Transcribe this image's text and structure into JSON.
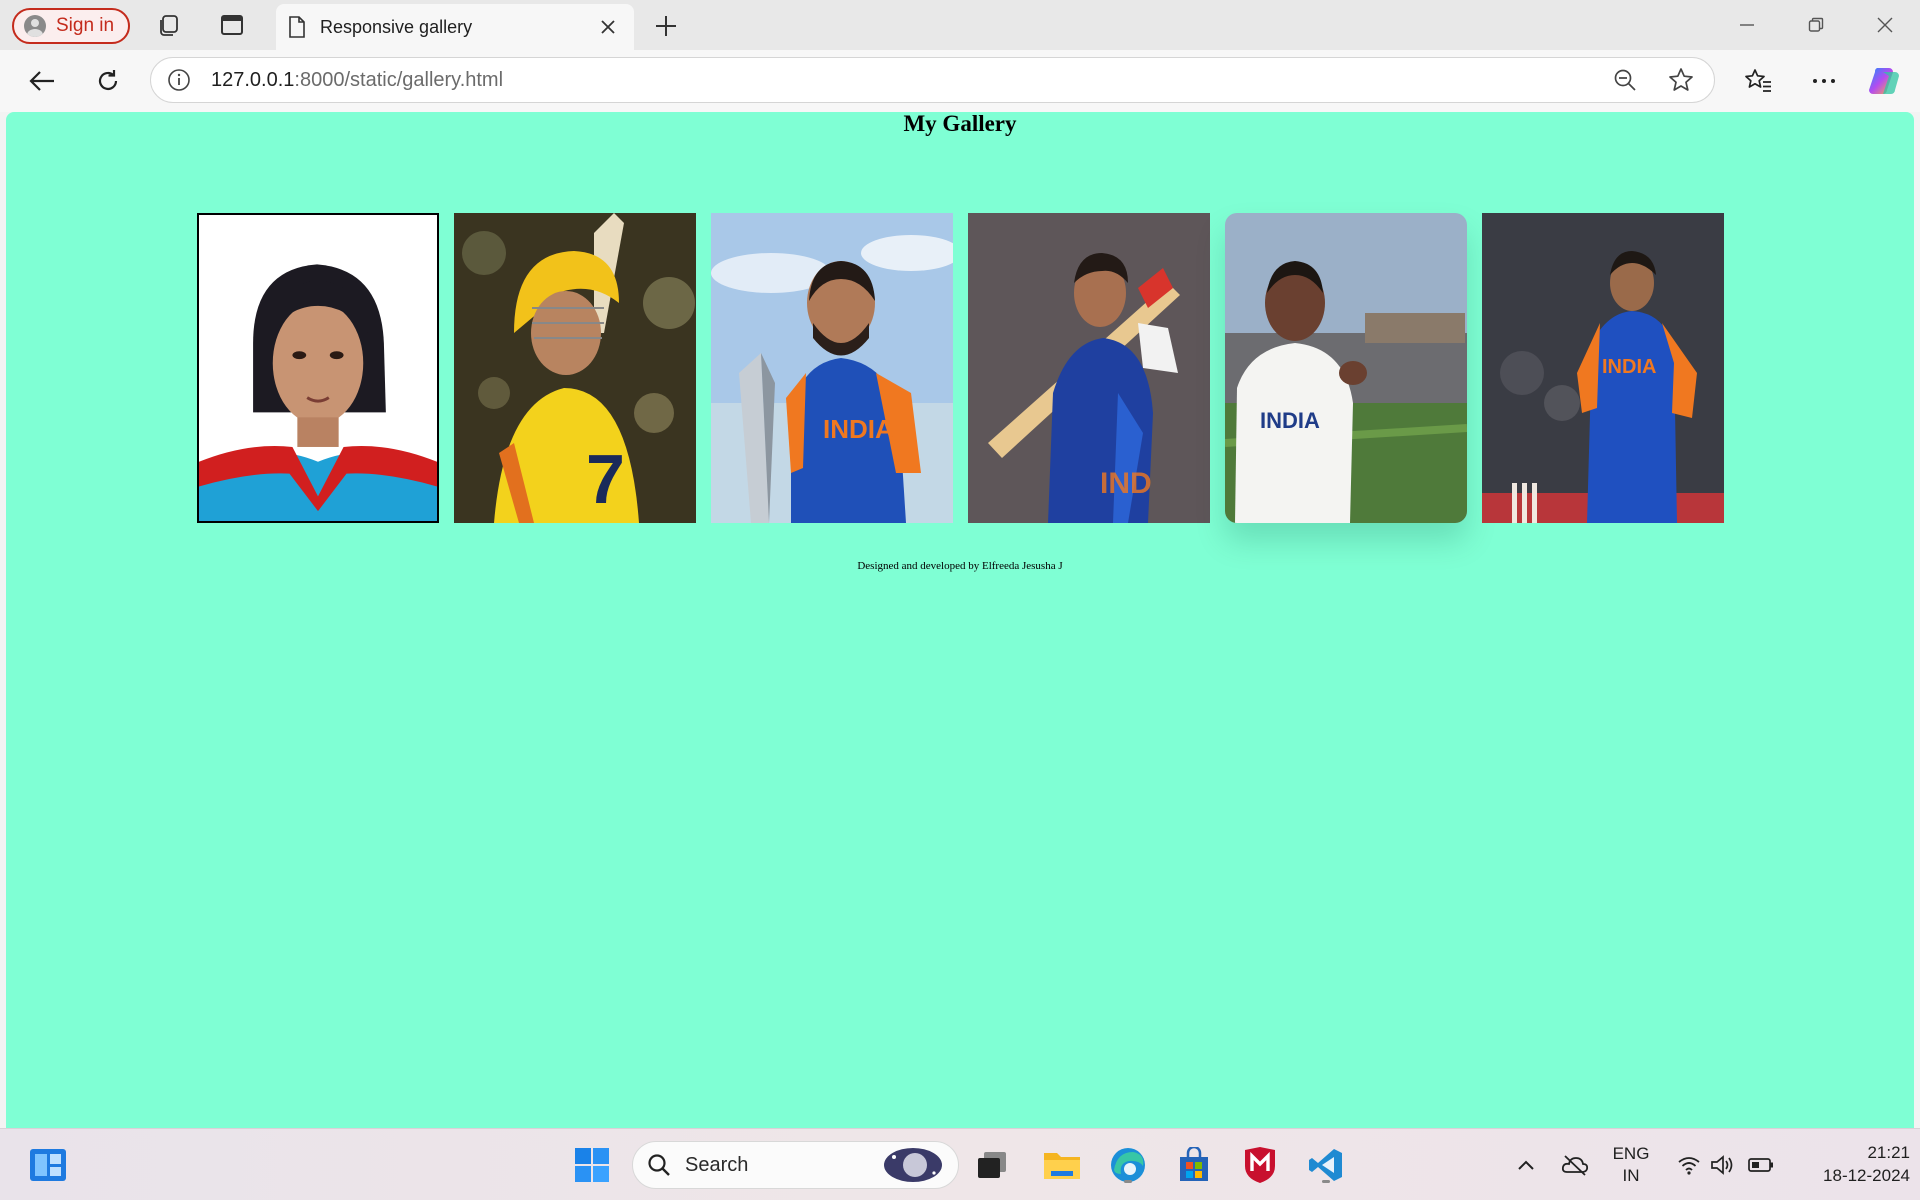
{
  "browser": {
    "signin_label": "Sign in",
    "tab_title": "Responsive gallery",
    "url_host": "127.0.0.1",
    "url_rest": ":8000/static/gallery.html"
  },
  "page": {
    "title": "My Gallery",
    "photos": [
      {
        "subject": "portrait photo"
      },
      {
        "subject": "cricketer in yellow jersey"
      },
      {
        "subject": "cricketer with trophy"
      },
      {
        "subject": "batsman in blue jersey"
      },
      {
        "subject": "cricketer in white test jersey"
      },
      {
        "subject": "bowler in blue-orange jersey"
      }
    ],
    "footer": "Designed and developed by Elfreeda Jesusha J"
  },
  "taskbar": {
    "search_label": "Search",
    "lang_line1": "ENG",
    "lang_line2": "IN",
    "time": "21:21",
    "date": "18-12-2024"
  },
  "colors": {
    "page_background": "#7fffd4",
    "signin_accent": "#c42b1c"
  }
}
